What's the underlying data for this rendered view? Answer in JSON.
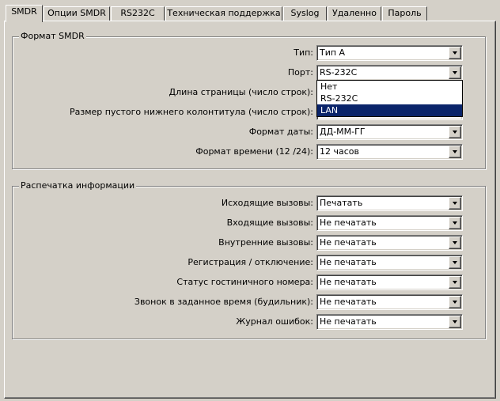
{
  "tabs": [
    "SMDR",
    "Опции SMDR",
    "RS232C",
    "Техническая поддержка",
    "Syslog",
    "Удаленно",
    "Пароль"
  ],
  "groups": {
    "format": {
      "title": "Формат SMDR"
    },
    "printout": {
      "title": "Распечатка информации"
    }
  },
  "format_fields": [
    {
      "label": "Тип:",
      "value": "Тип A"
    },
    {
      "label": "Порт:",
      "value": "RS-232C"
    },
    {
      "label": "Длина страницы (число строк):",
      "value": ""
    },
    {
      "label": "Размер пустого нижнего колонтитула (число строк):",
      "value": ""
    },
    {
      "label": "Формат даты:",
      "value": "ДД-ММ-ГГ"
    },
    {
      "label": "Формат времени (12 /24):",
      "value": "12 часов"
    }
  ],
  "port_dropdown": {
    "options": [
      "Нет",
      "RS-232C",
      "LAN"
    ],
    "selected": "LAN"
  },
  "print_fields": [
    {
      "label": "Исходящие вызовы:",
      "value": "Печатать"
    },
    {
      "label": "Входящие вызовы:",
      "value": "Не печатать"
    },
    {
      "label": "Внутренние вызовы:",
      "value": "Не печатать"
    },
    {
      "label": "Регистрация / отключение:",
      "value": "Не печатать"
    },
    {
      "label": "Статус гостиничного номера:",
      "value": "Не печатать"
    },
    {
      "label": "Звонок в заданное время (будильник):",
      "value": "Не печатать"
    },
    {
      "label": "Журнал ошибок:",
      "value": "Не печатать"
    }
  ]
}
